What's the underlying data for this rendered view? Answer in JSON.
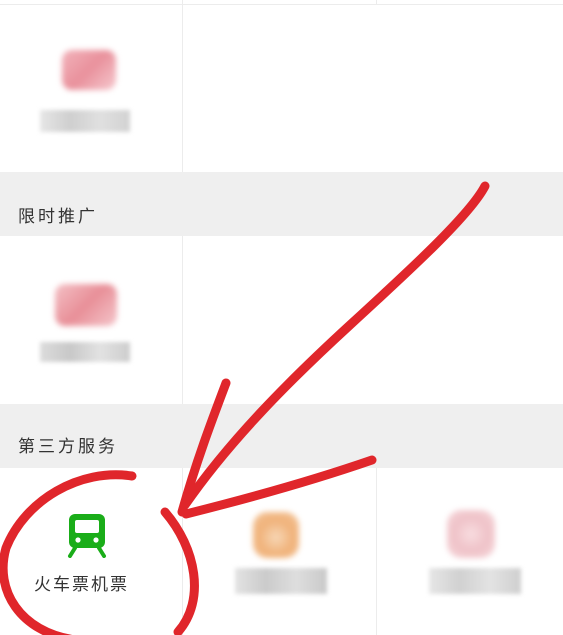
{
  "sections": {
    "limited_promo": {
      "title": "限时推广"
    },
    "third_party": {
      "title": "第三方服务"
    }
  },
  "services": {
    "train_flight": {
      "label": "火车票机票",
      "icon": "train-icon",
      "color": "#1aad19"
    }
  },
  "annotation": {
    "color": "#e0262b"
  }
}
